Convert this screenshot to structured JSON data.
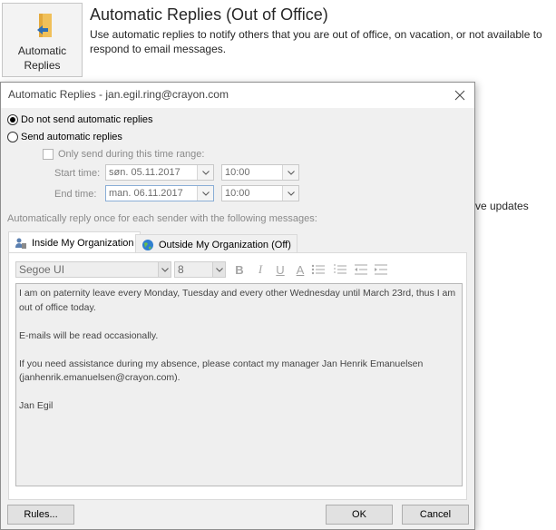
{
  "backstage": {
    "tile_label_line1": "Automatic",
    "tile_label_line2": "Replies",
    "title": "Automatic Replies (Out of Office)",
    "description": "Use automatic replies to notify others that you are out of office, on vacation, or not available to respond to email messages.",
    "right_fragment": "ve updates"
  },
  "dialog": {
    "title": "Automatic Replies - jan.egil.ring@crayon.com",
    "options": {
      "no_reply_label": "Do not send automatic replies",
      "send_reply_label": "Send automatic replies",
      "time_range_label": "Only send during this time range:",
      "selected": "no_reply"
    },
    "start": {
      "label": "Start time:",
      "date": "søn. 05.11.2017",
      "time": "10:00"
    },
    "end": {
      "label": "End time:",
      "date": "man. 06.11.2017",
      "time": "10:00"
    },
    "reply_once_label": "Automatically reply once for each sender with the following messages:",
    "tabs": [
      {
        "label": "Inside My Organization",
        "active": true
      },
      {
        "label": "Outside My Organization (Off)",
        "active": false
      }
    ],
    "toolbar": {
      "font": "Segoe UI",
      "size": "8",
      "bold": "B",
      "italic": "I",
      "underline": "U",
      "font_color": "A"
    },
    "message": {
      "p1": "I am on paternity leave every Monday, Tuesday and every other Wednesday until March 23rd, thus I am out of office today.",
      "p2": "E-mails will be read occasionally.",
      "p3": "If you need assistance during my absence, please contact my manager Jan Henrik Emanuelsen (janhenrik.emanuelsen@crayon.com).",
      "p4": "Jan Egil"
    },
    "buttons": {
      "rules": "Rules...",
      "ok": "OK",
      "cancel": "Cancel"
    }
  },
  "colors": {
    "accent_blue": "#2f6fb5",
    "folder_yellow": "#f0c05a",
    "dialog_bg": "#f0f0f0"
  }
}
